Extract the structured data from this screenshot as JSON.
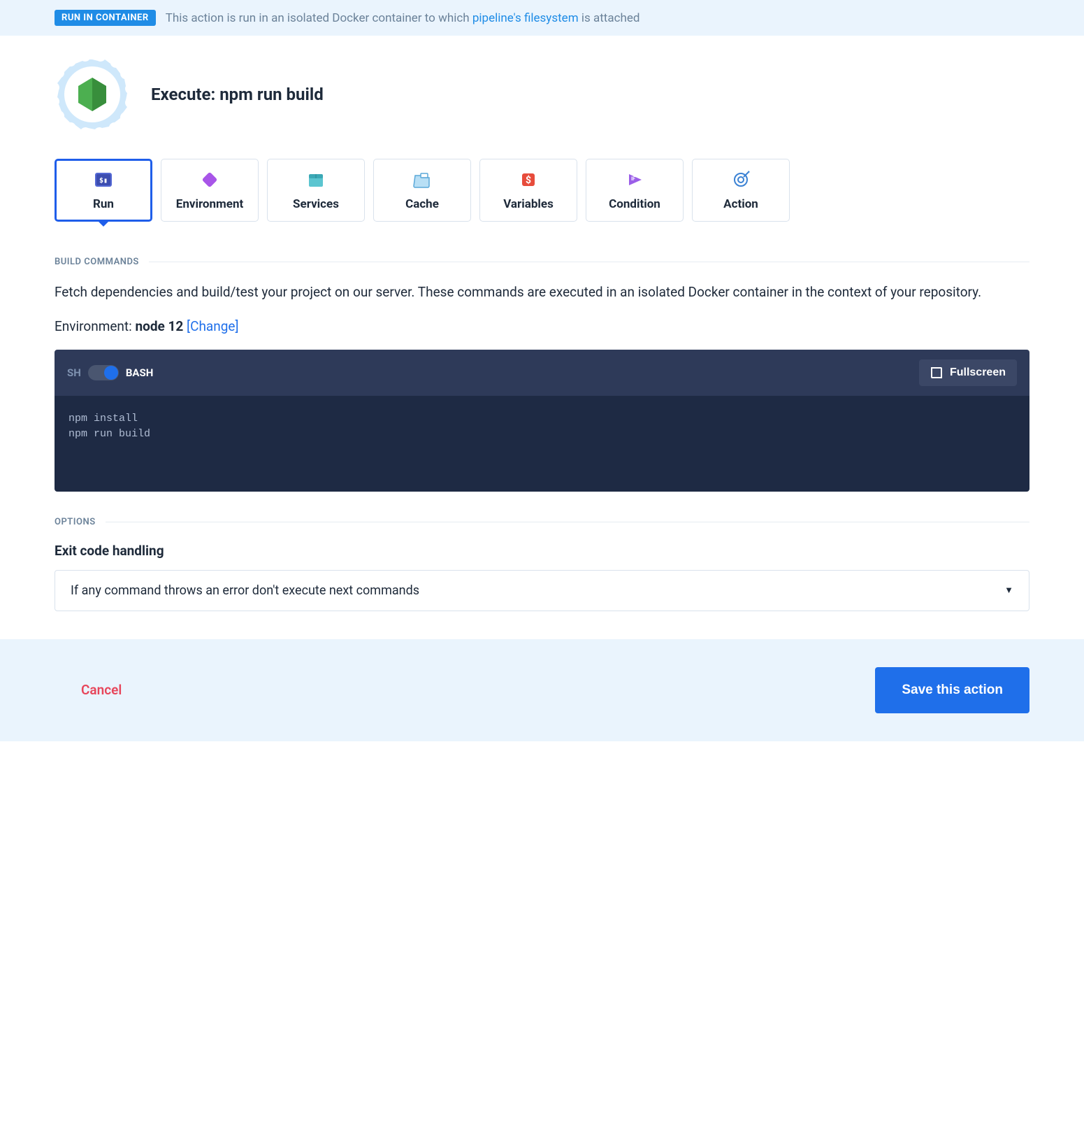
{
  "banner": {
    "badge": "RUN IN CONTAINER",
    "text_before": "This action is run in an isolated Docker container to which ",
    "link": "pipeline's filesystem",
    "text_after": " is attached"
  },
  "header": {
    "title": "Execute: npm run build"
  },
  "tabs": [
    {
      "label": "Run"
    },
    {
      "label": "Environment"
    },
    {
      "label": "Services"
    },
    {
      "label": "Cache"
    },
    {
      "label": "Variables"
    },
    {
      "label": "Condition"
    },
    {
      "label": "Action"
    }
  ],
  "build": {
    "section": "BUILD COMMANDS",
    "description": "Fetch dependencies and build/test your project on our server. These commands are executed in an isolated Docker container in the context of your repository.",
    "env_label": "Environment: ",
    "env_value": "node 12",
    "change": "[Change]"
  },
  "editor": {
    "sh": "SH",
    "bash": "BASH",
    "fullscreen": "Fullscreen",
    "code": "npm install\nnpm run build"
  },
  "options": {
    "section": "OPTIONS",
    "exit_heading": "Exit code handling",
    "exit_value": "If any command throws an error don't execute next commands"
  },
  "footer": {
    "cancel": "Cancel",
    "save": "Save this action"
  }
}
